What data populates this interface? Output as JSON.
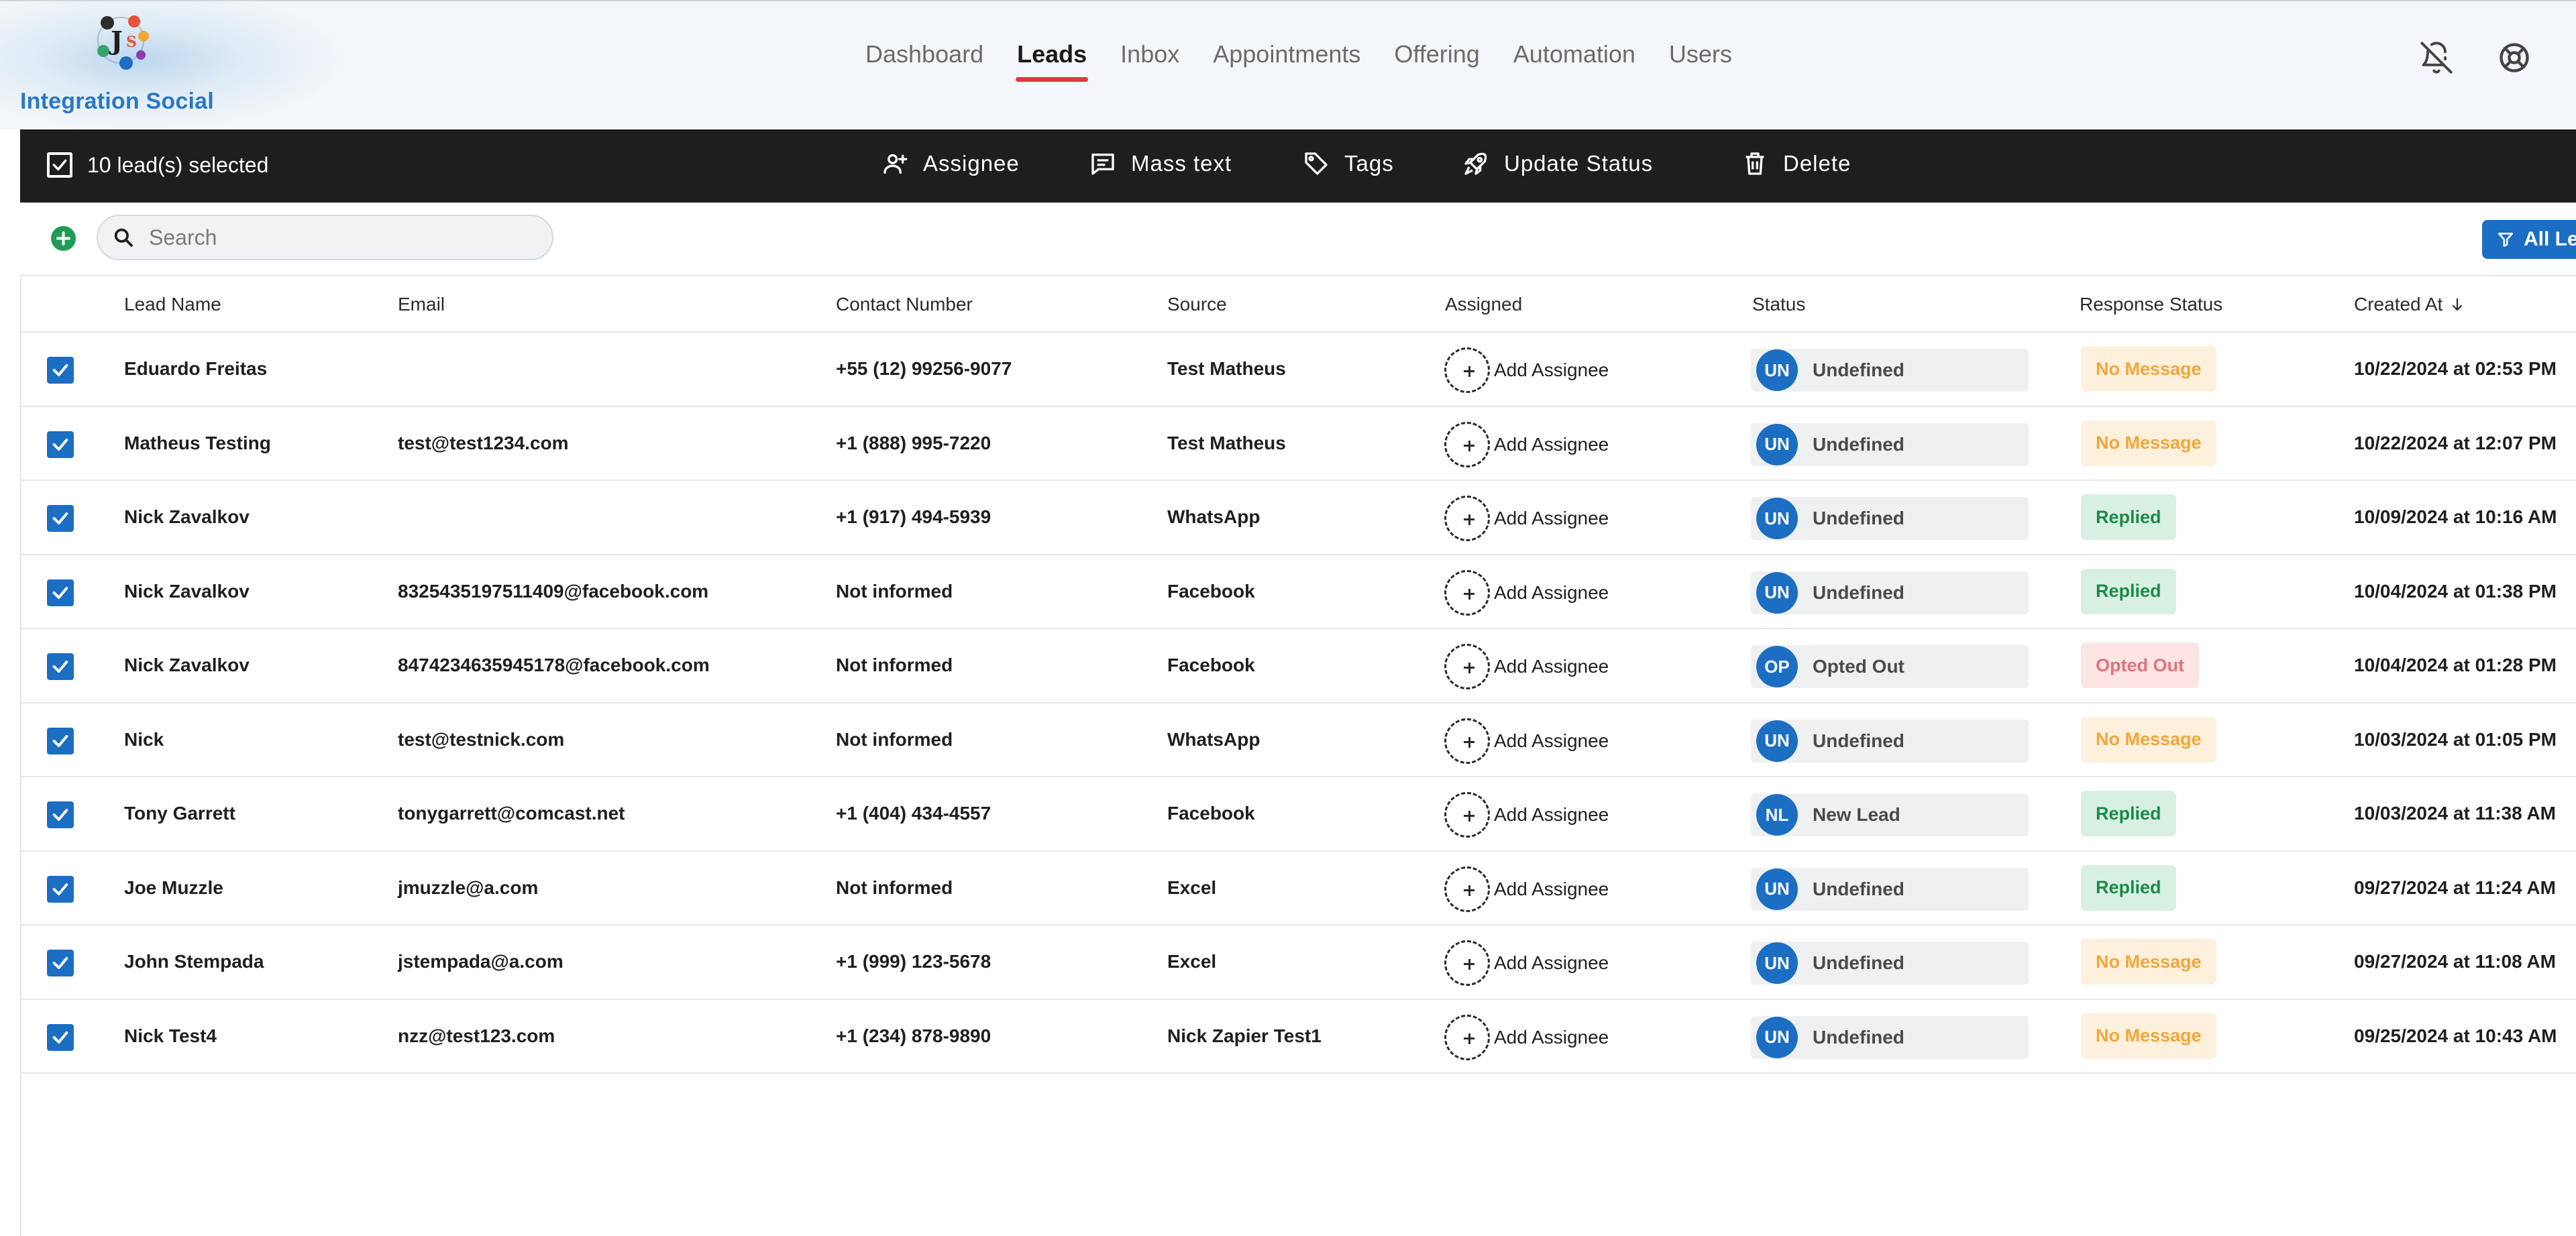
{
  "app": {
    "brand": "Integration Social",
    "nav": [
      "Dashboard",
      "Leads",
      "Inbox",
      "Appointments",
      "Offering",
      "Automation",
      "Users"
    ],
    "active_nav": "Leads",
    "icons": [
      "bell-off-icon",
      "help-lifebuoy-icon"
    ]
  },
  "actionbar": {
    "selected_text": "10 lead(s) selected",
    "actions": [
      {
        "label": "Assignee",
        "icon": "user-plus-icon"
      },
      {
        "label": "Mass text",
        "icon": "message-icon"
      },
      {
        "label": "Tags",
        "icon": "tag-icon"
      },
      {
        "label": "Update Status",
        "icon": "rocket-icon"
      },
      {
        "label": "Delete",
        "icon": "trash-icon"
      }
    ]
  },
  "toolbar": {
    "search_placeholder": "Search",
    "filter_label": "All Lea"
  },
  "table": {
    "columns": [
      "Lead Name",
      "Email",
      "Contact Number",
      "Source",
      "Assigned",
      "Status",
      "Response Status",
      "Created At"
    ],
    "sorted_column": "Created At",
    "assign_label": "Add Assignee",
    "rows": [
      {
        "name": "Eduardo Freitas",
        "email": "",
        "phone": "+55 (12) 99256-9077",
        "source": "Test Matheus",
        "status_code": "UN",
        "status": "Undefined",
        "response": "No Message",
        "created": "10/22/2024 at 02:53 PM"
      },
      {
        "name": "Matheus Testing",
        "email": "test@test1234.com",
        "phone": "+1 (888) 995-7220",
        "source": "Test Matheus",
        "status_code": "UN",
        "status": "Undefined",
        "response": "No Message",
        "created": "10/22/2024 at 12:07 PM"
      },
      {
        "name": "Nick Zavalkov",
        "email": "",
        "phone": "+1 (917) 494-5939",
        "source": "WhatsApp",
        "status_code": "UN",
        "status": "Undefined",
        "response": "Replied",
        "created": "10/09/2024 at 10:16 AM"
      },
      {
        "name": "Nick Zavalkov",
        "email": "8325435197511409@facebook.com",
        "phone": "Not informed",
        "source": "Facebook",
        "status_code": "UN",
        "status": "Undefined",
        "response": "Replied",
        "created": "10/04/2024 at 01:38 PM"
      },
      {
        "name": "Nick Zavalkov",
        "email": "8474234635945178@facebook.com",
        "phone": "Not informed",
        "source": "Facebook",
        "status_code": "OP",
        "status": "Opted Out",
        "response": "Opted Out",
        "created": "10/04/2024 at 01:28 PM"
      },
      {
        "name": "Nick",
        "email": "test@testnick.com",
        "phone": "Not informed",
        "source": "WhatsApp",
        "status_code": "UN",
        "status": "Undefined",
        "response": "No Message",
        "created": "10/03/2024 at 01:05 PM"
      },
      {
        "name": "Tony Garrett",
        "email": "tonygarrett@comcast.net",
        "phone": "+1 (404) 434-4557",
        "source": "Facebook",
        "status_code": "NL",
        "status": "New Lead",
        "response": "Replied",
        "created": "10/03/2024 at 11:38 AM"
      },
      {
        "name": "Joe Muzzle",
        "email": "jmuzzle@a.com",
        "phone": "Not informed",
        "source": "Excel",
        "status_code": "UN",
        "status": "Undefined",
        "response": "Replied",
        "created": "09/27/2024 at 11:24 AM"
      },
      {
        "name": "John Stempada",
        "email": "jstempada@a.com",
        "phone": "+1 (999) 123-5678",
        "source": "Excel",
        "status_code": "UN",
        "status": "Undefined",
        "response": "No Message",
        "created": "09/27/2024 at 11:08 AM"
      },
      {
        "name": "Nick Test4",
        "email": "nzz@test123.com",
        "phone": "+1 (234) 878-9890",
        "source": "Nick Zapier Test1",
        "status_code": "UN",
        "status": "Undefined",
        "response": "No Message",
        "created": "09/25/2024 at 10:43 AM"
      }
    ]
  }
}
